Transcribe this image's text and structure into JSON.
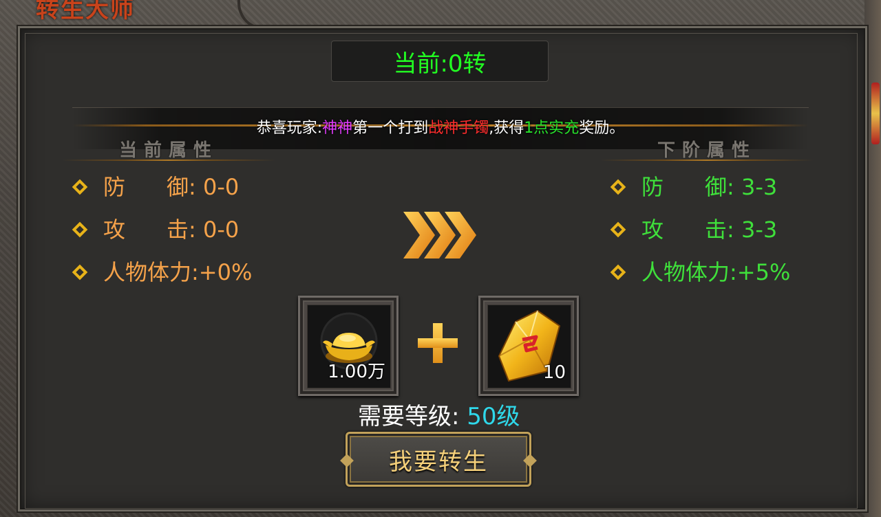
{
  "window": {
    "title": "转生大师"
  },
  "status": {
    "current": "当前:0转"
  },
  "notice": {
    "prefix": "恭喜玩家:",
    "player": "神神",
    "mid": "第一个打到",
    "item": "战神手镯",
    "mid2": ",获得",
    "reward": "1点实充",
    "suffix": "奖励。"
  },
  "sections": {
    "current": "当前属性",
    "next": "下阶属性"
  },
  "current_attrs": [
    {
      "label_a": "防",
      "label_b": "御",
      "value": ": 0-0"
    },
    {
      "label_a": "攻",
      "label_b": "击",
      "value": ": 0-0"
    },
    {
      "label": "人物体力",
      "value": ":+0%"
    }
  ],
  "next_attrs": [
    {
      "label_a": "防",
      "label_b": "御",
      "value": ": 3-3"
    },
    {
      "label_a": "攻",
      "label_b": "击",
      "value": ": 3-3"
    },
    {
      "label": "人物体力",
      "value": ":+5%"
    }
  ],
  "cost": {
    "gold": {
      "icon": "gold-ingot-icon",
      "count": "1.00万"
    },
    "gem": {
      "icon": "yellow-gem-icon",
      "count": "10"
    }
  },
  "requirement": {
    "label": "需要等级:",
    "value": "50级"
  },
  "action": {
    "label": "我要转生"
  },
  "colors": {
    "current_attr": "#f5a24a",
    "next_attr": "#3fe03b",
    "status": "#22ff22",
    "requirement_value": "#2fd8ea",
    "title": "#c8431b"
  }
}
